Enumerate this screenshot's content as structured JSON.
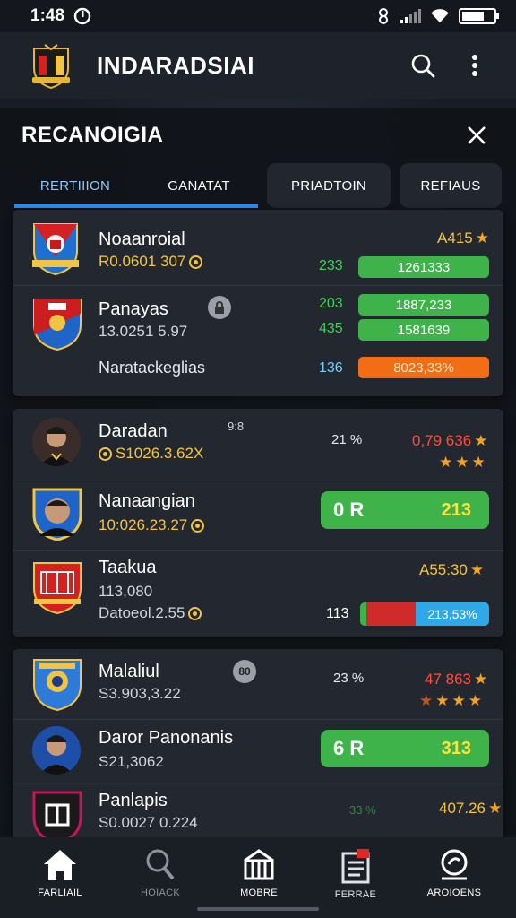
{
  "status": {
    "time": "1:48"
  },
  "app": {
    "title": "INDARADSIAI"
  },
  "sheet": {
    "title": "RECANOIGIA",
    "tabs": [
      "RERTIIION",
      "GANATAT",
      "PRIADTOIN",
      "REFIAUS"
    ]
  },
  "card1": {
    "team1": {
      "name": "Noaanroial",
      "sub": "R0.0601 307",
      "rating": "A415",
      "num": "233",
      "bar": "1261333"
    },
    "team2": {
      "name": "Panayas",
      "sub": "13.0251 5.97",
      "num1": "203",
      "bar1": "1887,233",
      "num2": "435",
      "bar2": "1581639"
    },
    "footer": {
      "label": "Naratackeglias",
      "num": "136",
      "bar": "8023,33%"
    }
  },
  "card2": {
    "p1": {
      "name": "Daradan",
      "tag": "9:8",
      "sub": "S1026.3.62X",
      "pct": "21 %",
      "rating": "0,79 636"
    },
    "p2": {
      "name": "Nanaangian",
      "sub": "10:026.23.27",
      "pill_left": "0 R",
      "pill_right": "213"
    },
    "p3": {
      "name": "Taakua",
      "line2": "113,080",
      "sub": "Datoeol.2.55",
      "rating": "A55:30",
      "num": "113",
      "bar": "213,53%"
    }
  },
  "card3": {
    "p1": {
      "name": "Malaliul",
      "badge": "80",
      "sub": "S3.903,3.22",
      "pct": "23 %",
      "rating": "47 863"
    },
    "p2": {
      "name": "Daror Panonanis",
      "sub": "S21,3062",
      "pill_left": "6 R",
      "pill_right": "313"
    },
    "p3": {
      "name": "Panlapis",
      "sub": "S0.0027 0.224",
      "pct": "33 %",
      "rating": "407.26"
    }
  },
  "nav": [
    "FARLIAIL",
    "HOIACK",
    "MOBRE",
    "FERRAE",
    "AROIOENS"
  ],
  "colors": {
    "accent": "#2d8cf0",
    "green": "#3db34a",
    "orange": "#f36d16",
    "gold": "#f2c443"
  }
}
